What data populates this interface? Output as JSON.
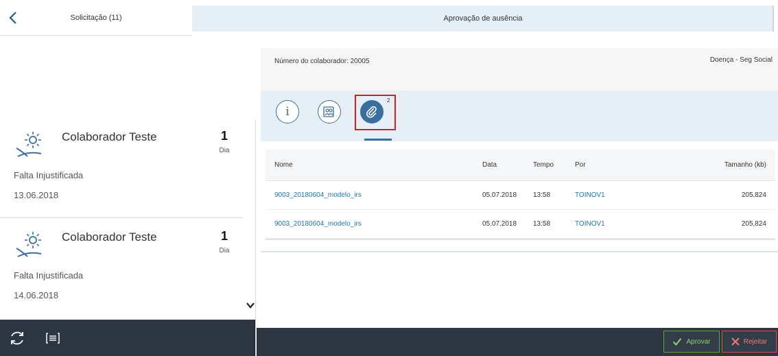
{
  "master": {
    "title": "Solicitação (11)",
    "items": [
      {
        "name": "Colaborador Teste",
        "quantity": "1",
        "unit": "Dia",
        "type": "Falta Injustificada",
        "date": "13.06.2018",
        "icon": "vacation-beach-icon"
      },
      {
        "name": "Colaborador Teste",
        "quantity": "1",
        "unit": "Dia",
        "type": "Falta Injustificada",
        "date": "14.06.2018",
        "icon": "vacation-beach-icon"
      }
    ]
  },
  "detail": {
    "title": "Aprovação de ausência",
    "employee_number": "Número do colaborador: 20005",
    "absence_type": "Doença - Seg Social",
    "tabs": [
      {
        "id": "info",
        "icon": "info-icon",
        "glyph": "i"
      },
      {
        "id": "people",
        "icon": "people-icon"
      },
      {
        "id": "attachments",
        "icon": "paperclip-icon",
        "count": "2",
        "selected": true
      }
    ],
    "table": {
      "columns": [
        "Nome",
        "Data",
        "Tempo",
        "Por",
        "Tamanho (kb)"
      ],
      "rows": [
        {
          "name": "9003_20180604_modelo_irs",
          "date": "05.07.2018",
          "time": "13:58",
          "by": "TOINOV1",
          "size": "205,824"
        },
        {
          "name": "9003_20180604_modelo_irs",
          "date": "05.07.2018",
          "time": "13:58",
          "by": "TOINOV1",
          "size": "205,824"
        }
      ]
    }
  },
  "footer": {
    "approve_label": "Aprovar",
    "reject_label": "Rejeitar"
  },
  "colors": {
    "accent": "#3a6e9e",
    "link": "#1f74b8",
    "footer_bg": "#2c3540",
    "approve": "#8fd16f",
    "reject": "#f07b78",
    "highlight": "#e0191a"
  }
}
